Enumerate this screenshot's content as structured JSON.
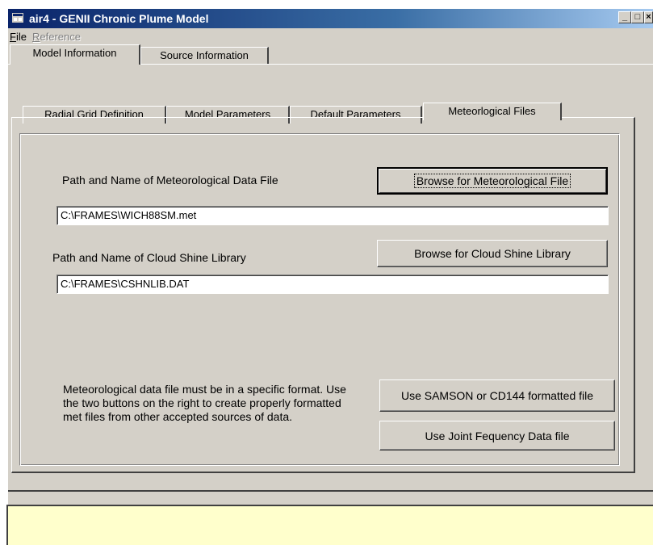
{
  "window": {
    "title": "air4 - GENII Chronic Plume Model",
    "controls": [
      "_",
      "□",
      "×"
    ]
  },
  "menu": {
    "file": "File",
    "reference": "Reference"
  },
  "main_tabs": [
    "Model Information",
    "Source Information"
  ],
  "sub_tabs": [
    "Radial Grid Definition",
    "Model Parameters",
    "Default Parameters",
    "Meteorlogical Files"
  ],
  "met": {
    "label": "Path and Name of Meteorological Data File",
    "value": "C:\\FRAMES\\WICH88SM.met",
    "browse_button": "Browse for Meteorological File"
  },
  "cloud": {
    "label": "Path and Name of Cloud Shine Library",
    "value": "C:\\FRAMES\\CSHNLIB.DAT",
    "browse_button": "Browse for Cloud Shine Library"
  },
  "note": "Meteorological data file must be in a specific format.  Use the two buttons on the right to create properly formatted met files from other accepted sources of data.",
  "buttons": {
    "samson": "Use SAMSON or CD144 formatted file",
    "joint": "Use Joint Fequency Data file"
  },
  "status": "",
  "colors": {
    "title_start": "#0a246a",
    "title_end": "#a6caf0",
    "face": "#d4d0c8",
    "status_bg": "#ffffcc"
  }
}
